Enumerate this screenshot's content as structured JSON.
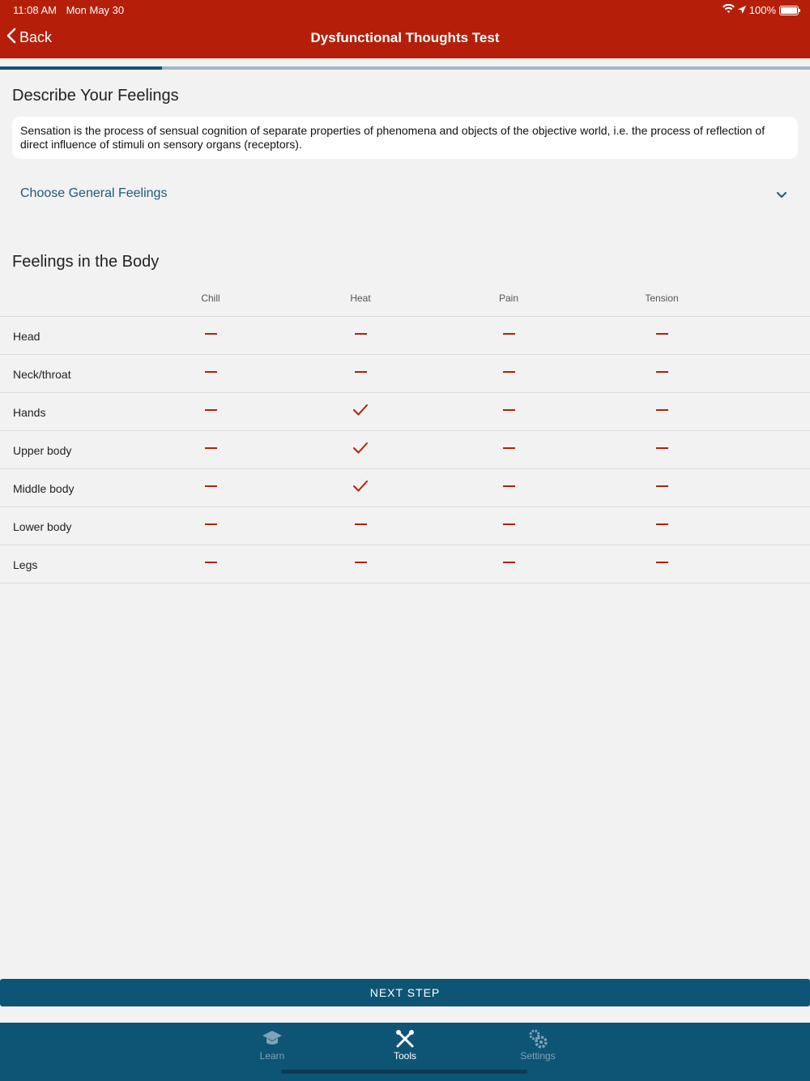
{
  "status": {
    "time": "11:08 AM",
    "date": "Mon May 30",
    "battery": "100%",
    "icons": [
      "wifi-icon",
      "location-icon",
      "battery-icon"
    ]
  },
  "nav": {
    "back_label": "Back",
    "title": "Dysfunctional Thoughts Test"
  },
  "progress": {
    "fraction": 0.2
  },
  "describe": {
    "title": "Describe Your Feelings",
    "description": "Sensation is the process of sensual cognition of separate properties of phenomena and objects of the objective world, i.e. the process of reflection of direct influence of stimuli on sensory organs (receptors).",
    "dropdown_label": "Choose General Feelings"
  },
  "body": {
    "title": "Feelings in the Body",
    "columns": [
      "Chill",
      "Heat",
      "Pain",
      "Tension"
    ],
    "rows": [
      {
        "label": "Head",
        "values": [
          false,
          false,
          false,
          false
        ]
      },
      {
        "label": "Neck/throat",
        "values": [
          false,
          false,
          false,
          false
        ]
      },
      {
        "label": "Hands",
        "values": [
          false,
          true,
          false,
          false
        ]
      },
      {
        "label": "Upper body",
        "values": [
          false,
          true,
          false,
          false
        ]
      },
      {
        "label": "Middle body",
        "values": [
          false,
          true,
          false,
          false
        ]
      },
      {
        "label": "Lower body",
        "values": [
          false,
          false,
          false,
          false
        ]
      },
      {
        "label": "Legs",
        "values": [
          false,
          false,
          false,
          false
        ]
      }
    ]
  },
  "next_button": "NEXT STEP",
  "tabs": [
    {
      "label": "Learn",
      "icon": "graduation-cap-icon",
      "active": false
    },
    {
      "label": "Tools",
      "icon": "tools-icon",
      "active": true
    },
    {
      "label": "Settings",
      "icon": "gears-icon",
      "active": false
    }
  ],
  "colors": {
    "brand_red": "#b51f0a",
    "brand_blue": "#0e5475",
    "link_blue": "#1d5a79",
    "background": "#f2f2f2"
  }
}
